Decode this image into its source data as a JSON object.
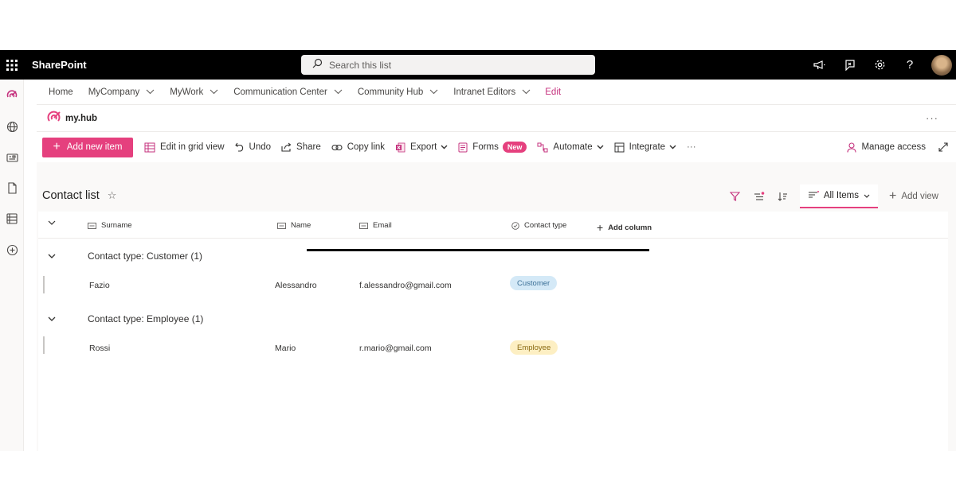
{
  "suite": {
    "app_name": "SharePoint",
    "search_placeholder": "Search this list"
  },
  "hub_nav": {
    "items": [
      {
        "label": "Home",
        "has_dropdown": false
      },
      {
        "label": "MyCompany",
        "has_dropdown": true
      },
      {
        "label": "MyWork",
        "has_dropdown": true
      },
      {
        "label": "Communication Center",
        "has_dropdown": true
      },
      {
        "label": "Community Hub",
        "has_dropdown": true
      },
      {
        "label": "Intranet Editors",
        "has_dropdown": true
      }
    ],
    "edit_label": "Edit"
  },
  "site": {
    "logo_text": "my.hub",
    "more_label": "···"
  },
  "command_bar": {
    "add_new_item": "Add new item",
    "edit_grid": "Edit in grid view",
    "undo": "Undo",
    "share": "Share",
    "copy_link": "Copy link",
    "export": "Export",
    "forms": "Forms",
    "forms_badge": "New",
    "automate": "Automate",
    "integrate": "Integrate",
    "more": "···",
    "manage_access": "Manage access"
  },
  "list": {
    "title": "Contact list",
    "view_name": "All Items",
    "add_view": "Add view",
    "columns": {
      "surname": "Surname",
      "name": "Name",
      "email": "Email",
      "contact_type": "Contact type",
      "add_column": "Add column"
    },
    "groups": [
      {
        "header": "Contact type: Customer (1)",
        "rows": [
          {
            "surname": "Fazio",
            "name": "Alessandro",
            "email": "f.alessandro@gmail.com",
            "contact_type": "Customer"
          }
        ]
      },
      {
        "header": "Contact type: Employee (1)",
        "rows": [
          {
            "surname": "Rossi",
            "name": "Mario",
            "email": "r.mario@gmail.com",
            "contact_type": "Employee"
          }
        ]
      }
    ]
  },
  "colors": {
    "accent": "#e5407e",
    "suite_bar": "#000000",
    "customer_pill_bg": "#d4e9f7",
    "customer_pill_text": "#3a6f96",
    "employee_pill_bg": "#fdefc3",
    "employee_pill_text": "#8a6a12"
  }
}
